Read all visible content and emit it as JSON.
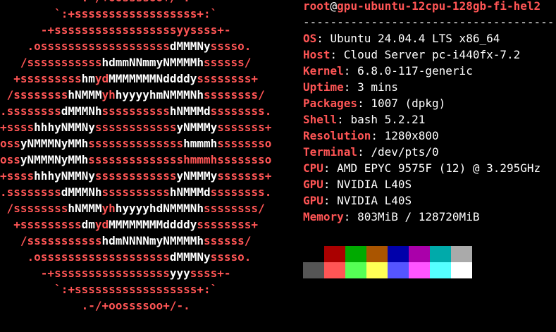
{
  "logo": {
    "lines": [
      [
        [
          "r",
          "            .-/+oossssoo+/-.            "
        ]
      ],
      [
        [
          "r",
          "        `:+ssssssssssssssssss+:`        "
        ]
      ],
      [
        [
          "r",
          "      -+ssssssssssssssssssyyssss+-      "
        ]
      ],
      [
        [
          "r",
          "    .osssssssssssssssssss"
        ],
        [
          "w",
          "dMMMNy"
        ],
        [
          "r",
          "sssso.    "
        ]
      ],
      [
        [
          "r",
          "   /sssssssssss"
        ],
        [
          "w",
          "hdmmNNmmyNMMMMh"
        ],
        [
          "r",
          "ssssss/   "
        ]
      ],
      [
        [
          "r",
          "  +sssssssss"
        ],
        [
          "w",
          "hm"
        ],
        [
          "r",
          "yd"
        ],
        [
          "w",
          "MMMMMMMNddddy"
        ],
        [
          "r",
          "ssssssss+  "
        ]
      ],
      [
        [
          "r",
          " /ssssssss"
        ],
        [
          "w",
          "hNMMM"
        ],
        [
          "r",
          "yh"
        ],
        [
          "w",
          "hyyyyhmNMMMNh"
        ],
        [
          "r",
          "ssssssss/ "
        ]
      ],
      [
        [
          "r",
          ".ssssssss"
        ],
        [
          "w",
          "dMMMNh"
        ],
        [
          "r",
          "ssssssssss"
        ],
        [
          "w",
          "hNMMMd"
        ],
        [
          "r",
          "ssssssss."
        ]
      ],
      [
        [
          "r",
          "+ssss"
        ],
        [
          "w",
          "hhhyNMMNy"
        ],
        [
          "r",
          "ssssssssssss"
        ],
        [
          "w",
          "yNMMMy"
        ],
        [
          "r",
          "sssssss+"
        ]
      ],
      [
        [
          "r",
          "oss"
        ],
        [
          "w",
          "yNMMMNyMMh"
        ],
        [
          "r",
          "ssssssssssssss"
        ],
        [
          "w",
          "hmmmh"
        ],
        [
          "r",
          "ssssssso"
        ]
      ],
      [
        [
          "r",
          "oss"
        ],
        [
          "w",
          "yNMMMNyMMh"
        ],
        [
          "r",
          "sssssssssssssshmmmhssssssso"
        ]
      ],
      [
        [
          "r",
          "+ssss"
        ],
        [
          "w",
          "hhhyNMMNy"
        ],
        [
          "r",
          "ssssssssssss"
        ],
        [
          "w",
          "yNMMMy"
        ],
        [
          "r",
          "sssssss+"
        ]
      ],
      [
        [
          "r",
          ".ssssssss"
        ],
        [
          "w",
          "dMMMNh"
        ],
        [
          "r",
          "ssssssssss"
        ],
        [
          "w",
          "hNMMMd"
        ],
        [
          "r",
          "ssssssss."
        ]
      ],
      [
        [
          "r",
          " /ssssssss"
        ],
        [
          "w",
          "hNMMM"
        ],
        [
          "r",
          "yh"
        ],
        [
          "w",
          "hyyyyhdNMMMNh"
        ],
        [
          "r",
          "ssssssss/ "
        ]
      ],
      [
        [
          "r",
          "  +sssssssss"
        ],
        [
          "w",
          "dm"
        ],
        [
          "r",
          "yd"
        ],
        [
          "w",
          "MMMMMMMMddddy"
        ],
        [
          "r",
          "ssssssss+  "
        ]
      ],
      [
        [
          "r",
          "   /sssssssssss"
        ],
        [
          "w",
          "hdmNNNNmyNMMMMh"
        ],
        [
          "r",
          "ssssss/   "
        ]
      ],
      [
        [
          "r",
          "    .osssssssssssssssssss"
        ],
        [
          "w",
          "dMMMNy"
        ],
        [
          "r",
          "sssso.    "
        ]
      ],
      [
        [
          "r",
          "      -+sssssssssssssssss"
        ],
        [
          "w",
          "yyy"
        ],
        [
          "r",
          "ssss+-      "
        ]
      ],
      [
        [
          "r",
          "        `:+ssssssssssssssssss+:`        "
        ]
      ],
      [
        [
          "r",
          "            .-/+oossssoo+/-.            "
        ]
      ]
    ]
  },
  "info": {
    "user": "root",
    "at": "@",
    "host": "gpu-ubuntu-12cpu-128gb-fi-hel2",
    "separator": "--------------------------------------",
    "rows": [
      {
        "key": "OS",
        "value": "Ubuntu 24.04.4 LTS x86_64"
      },
      {
        "key": "Host",
        "value": "Cloud Server pc-i440fx-7.2"
      },
      {
        "key": "Kernel",
        "value": "6.8.0-117-generic"
      },
      {
        "key": "Uptime",
        "value": "3 mins"
      },
      {
        "key": "Packages",
        "value": "1007 (dpkg)"
      },
      {
        "key": "Shell",
        "value": "bash 5.2.21"
      },
      {
        "key": "Resolution",
        "value": "1280x800"
      },
      {
        "key": "Terminal",
        "value": "/dev/pts/0"
      },
      {
        "key": "CPU",
        "value": "AMD EPYC 9575F (12) @ 3.295GHz"
      },
      {
        "key": "GPU",
        "value": "NVIDIA L40S"
      },
      {
        "key": "GPU",
        "value": "NVIDIA L40S"
      },
      {
        "key": "Memory",
        "value": "803MiB / 128720MiB"
      }
    ],
    "colon": ": "
  },
  "palette": {
    "normal": [
      "#000000",
      "#aa0000",
      "#00aa00",
      "#aa5500",
      "#0000aa",
      "#aa00aa",
      "#00aaaa",
      "#aaaaaa"
    ],
    "bright": [
      "#555555",
      "#ff5555",
      "#55ff55",
      "#ffff55",
      "#5555ff",
      "#ff55ff",
      "#55ffff",
      "#ffffff"
    ]
  }
}
